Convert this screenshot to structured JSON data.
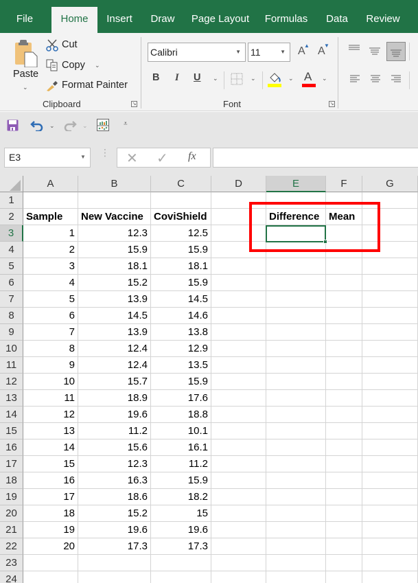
{
  "tabs": [
    {
      "label": "File",
      "active": false
    },
    {
      "label": "Home",
      "active": true
    },
    {
      "label": "Insert",
      "active": false
    },
    {
      "label": "Draw",
      "active": false
    },
    {
      "label": "Page Layout",
      "active": false
    },
    {
      "label": "Formulas",
      "active": false
    },
    {
      "label": "Data",
      "active": false
    },
    {
      "label": "Review",
      "active": false
    }
  ],
  "ribbon": {
    "clipboard": {
      "paste_label": "Paste",
      "cut_label": "Cut",
      "copy_label": "Copy",
      "format_painter_label": "Format Painter",
      "group_label": "Clipboard"
    },
    "font": {
      "font_name": "Calibri",
      "font_size": "11",
      "bold_label": "B",
      "italic_label": "I",
      "underline_label": "U",
      "font_color_label": "A",
      "grow_label": "A",
      "shrink_label": "A",
      "group_label": "Font",
      "fill_color": "#ffff00",
      "font_color": "#ff0000"
    }
  },
  "formula_bar": {
    "name_box": "E3",
    "fx_label": "fx",
    "formula_value": ""
  },
  "sheet": {
    "columns": [
      "A",
      "B",
      "C",
      "D",
      "E",
      "F",
      "G"
    ],
    "selected_column": "E",
    "selected_row": 3,
    "row_numbers": [
      "1",
      "2",
      "3",
      "4",
      "5",
      "6",
      "7",
      "8",
      "9",
      "10",
      "11",
      "12",
      "13",
      "14",
      "15",
      "16",
      "17",
      "18",
      "19",
      "20",
      "21",
      "22",
      "23",
      "24"
    ],
    "headers": {
      "A2": "Sample",
      "B2": "New Vaccine",
      "C2": "CoviShield",
      "E2": "Difference",
      "F2": "Mean"
    },
    "rows": [
      {
        "sample": "1",
        "new_vaccine": "12.3",
        "covishield": "12.5"
      },
      {
        "sample": "2",
        "new_vaccine": "15.9",
        "covishield": "15.9"
      },
      {
        "sample": "3",
        "new_vaccine": "18.1",
        "covishield": "18.1"
      },
      {
        "sample": "4",
        "new_vaccine": "15.2",
        "covishield": "15.9"
      },
      {
        "sample": "5",
        "new_vaccine": "13.9",
        "covishield": "14.5"
      },
      {
        "sample": "6",
        "new_vaccine": "14.5",
        "covishield": "14.6"
      },
      {
        "sample": "7",
        "new_vaccine": "13.9",
        "covishield": "13.8"
      },
      {
        "sample": "8",
        "new_vaccine": "12.4",
        "covishield": "12.9"
      },
      {
        "sample": "9",
        "new_vaccine": "12.4",
        "covishield": "13.5"
      },
      {
        "sample": "10",
        "new_vaccine": "15.7",
        "covishield": "15.9"
      },
      {
        "sample": "11",
        "new_vaccine": "18.9",
        "covishield": "17.6"
      },
      {
        "sample": "12",
        "new_vaccine": "19.6",
        "covishield": "18.8"
      },
      {
        "sample": "13",
        "new_vaccine": "11.2",
        "covishield": "10.1"
      },
      {
        "sample": "14",
        "new_vaccine": "15.6",
        "covishield": "16.1"
      },
      {
        "sample": "15",
        "new_vaccine": "12.3",
        "covishield": "11.2"
      },
      {
        "sample": "16",
        "new_vaccine": "16.3",
        "covishield": "15.9"
      },
      {
        "sample": "17",
        "new_vaccine": "18.6",
        "covishield": "18.2"
      },
      {
        "sample": "18",
        "new_vaccine": "15.2",
        "covishield": "15"
      },
      {
        "sample": "19",
        "new_vaccine": "19.6",
        "covishield": "19.6"
      },
      {
        "sample": "20",
        "new_vaccine": "17.3",
        "covishield": "17.3"
      }
    ]
  },
  "annotation": {
    "color": "#ff0000"
  },
  "colors": {
    "brand": "#217346",
    "selection": "#217346"
  }
}
